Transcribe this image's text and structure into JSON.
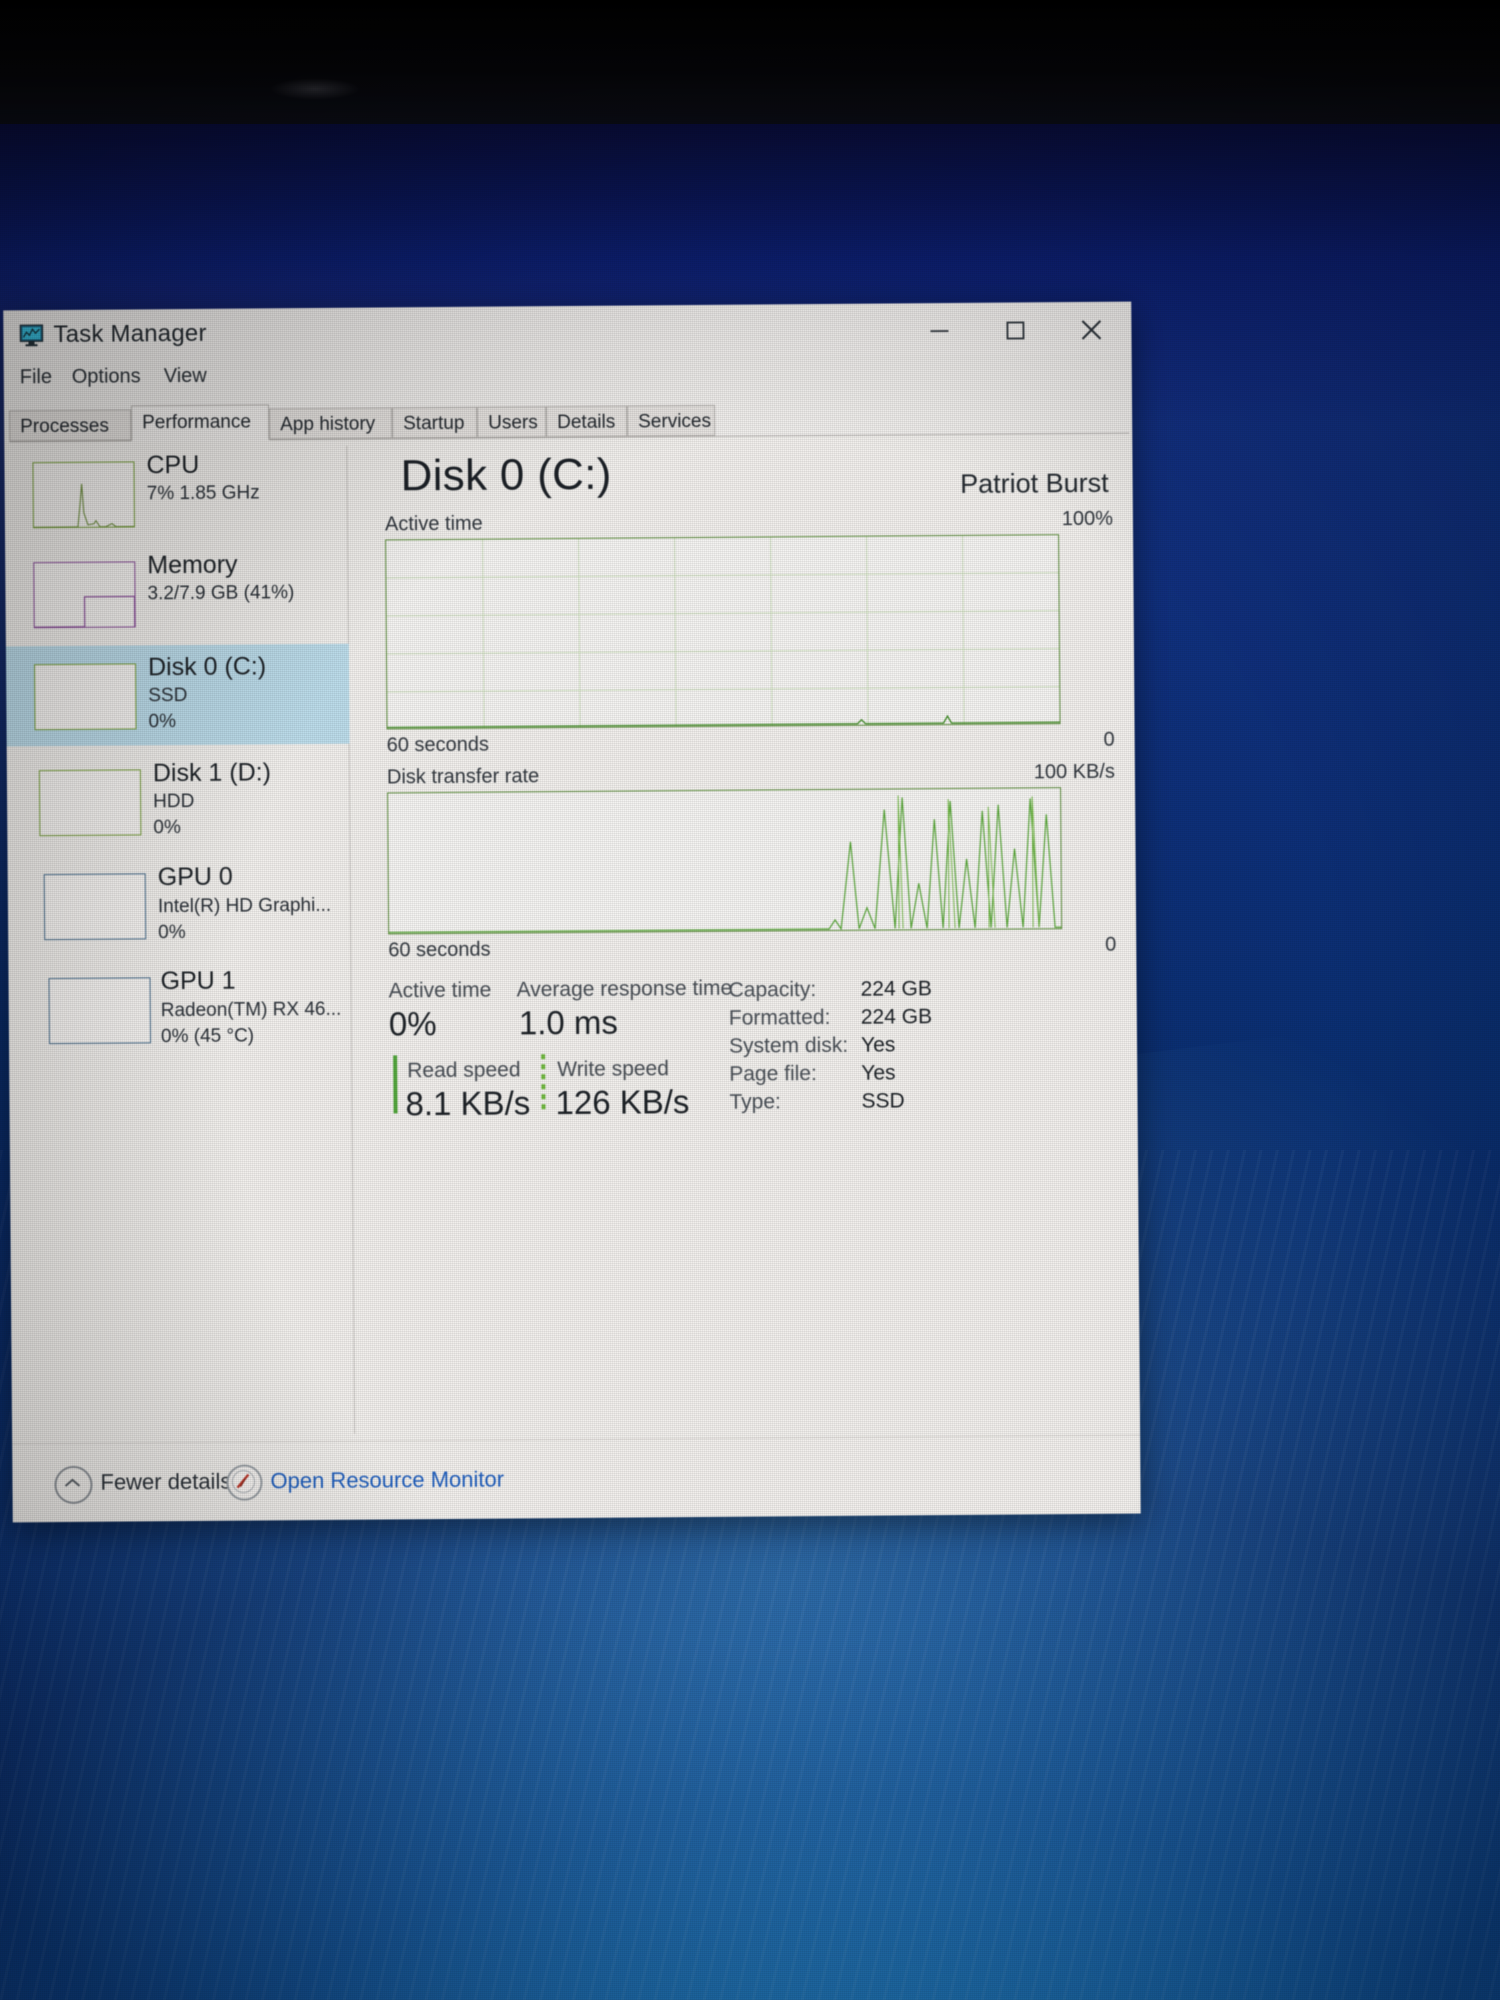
{
  "window": {
    "title": "Task Manager",
    "icon": "task-manager-icon",
    "controls": {
      "minimize": "minimize-icon",
      "maximize": "maximize-icon",
      "close": "close-icon"
    }
  },
  "menu": {
    "items": [
      "File",
      "Options",
      "View"
    ]
  },
  "tabs": [
    {
      "label": "Processes",
      "active": false
    },
    {
      "label": "Performance",
      "active": true
    },
    {
      "label": "App history",
      "active": false
    },
    {
      "label": "Startup",
      "active": false
    },
    {
      "label": "Users",
      "active": false
    },
    {
      "label": "Details",
      "active": false
    },
    {
      "label": "Services",
      "active": false
    }
  ],
  "sidebar": {
    "items": [
      {
        "name": "CPU",
        "line1": "7%  1.85 GHz",
        "line2": "",
        "selected": false,
        "thumb": "cpu-sparkline"
      },
      {
        "name": "Memory",
        "line1": "3.2/7.9 GB (41%)",
        "line2": "",
        "selected": false,
        "thumb": "memory-sparkline"
      },
      {
        "name": "Disk 0 (C:)",
        "line1": "SSD",
        "line2": "0%",
        "selected": true,
        "thumb": "disk0-sparkline"
      },
      {
        "name": "Disk 1 (D:)",
        "line1": "HDD",
        "line2": "0%",
        "selected": false,
        "thumb": "disk1-sparkline"
      },
      {
        "name": "GPU 0",
        "line1": "Intel(R) HD Graphi...",
        "line2": "0%",
        "selected": false,
        "thumb": "gpu0-sparkline"
      },
      {
        "name": "GPU 1",
        "line1": "Radeon(TM) RX 46...",
        "line2": "0% (45 °C)",
        "selected": false,
        "thumb": "gpu1-sparkline"
      }
    ]
  },
  "main": {
    "title": "Disk 0 (C:)",
    "device": "Patriot Burst",
    "graph_active": {
      "label": "Active time",
      "max_label": "100%",
      "x_label": "60 seconds",
      "min_label": "0"
    },
    "graph_transfer": {
      "label": "Disk transfer rate",
      "max_label": "100 KB/s",
      "x_label": "60 seconds",
      "min_label": "0"
    },
    "stats": {
      "active_time_label": "Active time",
      "active_time_value": "0%",
      "avg_response_label": "Average response time",
      "avg_response_value": "1.0 ms",
      "read_speed_label": "Read speed",
      "read_speed_value": "8.1 KB/s",
      "write_speed_label": "Write speed",
      "write_speed_value": "126 KB/s"
    },
    "properties": [
      {
        "key": "Capacity:",
        "value": "224 GB"
      },
      {
        "key": "Formatted:",
        "value": "224 GB"
      },
      {
        "key": "System disk:",
        "value": "Yes"
      },
      {
        "key": "Page file:",
        "value": "Yes"
      },
      {
        "key": "Type:",
        "value": "SSD"
      }
    ]
  },
  "footer": {
    "fewer_details": "Fewer details",
    "fewer_details_icon": "chevron-up-circle-icon",
    "resource_monitor": "Open Resource Monitor",
    "resource_monitor_icon": "resource-monitor-icon"
  },
  "chart_data": [
    {
      "type": "area",
      "title": "Active time",
      "ylabel": "",
      "xlabel": "60 seconds",
      "ylim": [
        0,
        100
      ],
      "ytick_labels": [
        "100%",
        "0"
      ],
      "grid": true,
      "x": [
        0,
        5,
        10,
        15,
        20,
        25,
        30,
        35,
        40,
        45,
        50,
        55,
        60,
        65,
        70,
        75,
        80,
        85,
        90,
        95,
        100
      ],
      "values": [
        0,
        0,
        0,
        0,
        0,
        0,
        0,
        0,
        0,
        0,
        0,
        0,
        0,
        0,
        0,
        0,
        1,
        0,
        0,
        2,
        0
      ],
      "line_color": "#3f8c24"
    },
    {
      "type": "area",
      "title": "Disk transfer rate",
      "ylabel": "",
      "xlabel": "60 seconds",
      "ylim": [
        0,
        100
      ],
      "ytick_labels": [
        "100 KB/s",
        "0"
      ],
      "grid": false,
      "x": [
        0,
        5,
        10,
        15,
        20,
        25,
        30,
        35,
        40,
        45,
        50,
        55,
        60,
        62,
        64,
        66,
        68,
        70,
        72,
        74,
        76,
        78,
        80,
        82,
        84,
        86,
        88,
        90,
        92,
        94,
        96,
        98,
        100
      ],
      "values": [
        0,
        0,
        0,
        0,
        0,
        0,
        0,
        0,
        0,
        0,
        0,
        0,
        0,
        0,
        0,
        0,
        2,
        70,
        10,
        88,
        96,
        30,
        78,
        95,
        40,
        86,
        92,
        25,
        83,
        70,
        60,
        95,
        88
      ],
      "line_color": "#5aa83a"
    }
  ]
}
